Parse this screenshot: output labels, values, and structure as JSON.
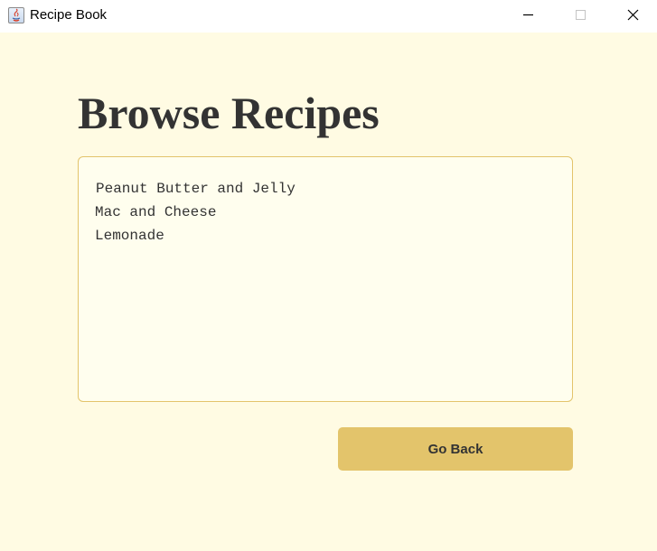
{
  "window": {
    "title": "Recipe Book",
    "icon": "java-app-icon",
    "controls": [
      "minimize-icon",
      "maximize-icon",
      "close-icon"
    ]
  },
  "main": {
    "heading": "Browse Recipes",
    "recipes": [
      "Peanut Butter and Jelly",
      "Mac and Cheese",
      "Lemonade"
    ],
    "back_button_label": "Go Back"
  },
  "colors": {
    "background": "#fffbe3",
    "list_background": "#fffeee",
    "accent": "#e3c46b",
    "text": "#333333"
  }
}
